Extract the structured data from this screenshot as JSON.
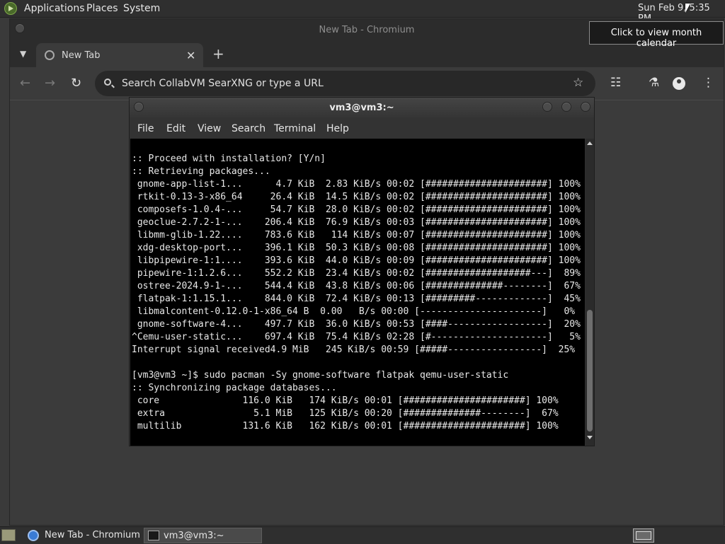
{
  "top_panel": {
    "menus": [
      "Applications",
      "Places",
      "System"
    ],
    "clock": "Sun Feb  9,  5:35 PM",
    "tooltip": "Click to view month calendar"
  },
  "chromium": {
    "window_title": "New Tab - Chromium",
    "tab_title": "New Tab",
    "omnibox_placeholder": "Search CollabVM SearXNG or type a URL"
  },
  "terminal": {
    "window_title": "vm3@vm3:~",
    "menus": [
      "File",
      "Edit",
      "View",
      "Search",
      "Terminal",
      "Help"
    ],
    "lines": [
      ":: Proceed with installation? [Y/n]",
      ":: Retrieving packages...",
      " gnome-app-list-1...      4.7 KiB  2.83 KiB/s 00:02 [######################] 100%",
      " rtkit-0.13-3-x86_64     26.4 KiB  14.5 KiB/s 00:02 [######################] 100%",
      " composefs-1.0.4-...     54.7 KiB  28.0 KiB/s 00:02 [######################] 100%",
      " geoclue-2.7.2-1-...    206.4 KiB  76.9 KiB/s 00:03 [######################] 100%",
      " libmm-glib-1.22....    783.6 KiB   114 KiB/s 00:07 [######################] 100%",
      " xdg-desktop-port...    396.1 KiB  50.3 KiB/s 00:08 [######################] 100%",
      " libpipewire-1:1....    393.6 KiB  44.0 KiB/s 00:09 [######################] 100%",
      " pipewire-1:1.2.6...    552.2 KiB  23.4 KiB/s 00:02 [###################---]  89%",
      " ostree-2024.9-1-...    544.4 KiB  43.8 KiB/s 00:06 [##############--------]  67%",
      " flatpak-1:1.15.1...    844.0 KiB  72.4 KiB/s 00:13 [#########-------------]  45%",
      " libmalcontent-0.12.0-1-x86_64 B  0.00   B/s 00:00 [----------------------]   0%",
      " gnome-software-4...    497.7 KiB  36.0 KiB/s 00:53 [####------------------]  20%",
      "^Cemu-user-static...    697.4 KiB  75.4 KiB/s 02:28 [#---------------------]   5%",
      "Interrupt signal received4.9 MiB   245 KiB/s 00:59 [#####-----------------]  25%",
      "",
      "[vm3@vm3 ~]$ sudo pacman -Sy gnome-software flatpak qemu-user-static",
      ":: Synchronizing package databases...",
      " core               116.0 KiB   174 KiB/s 00:01 [######################] 100%",
      " extra                5.1 MiB   125 KiB/s 00:20 [##############--------]  67%",
      " multilib           131.6 KiB   162 KiB/s 00:01 [######################] 100%"
    ]
  },
  "taskbar": {
    "tasks": [
      "New Tab - Chromium",
      "vm3@vm3:~"
    ]
  },
  "icons": {
    "nav": [
      "back-icon",
      "forward-icon",
      "reload-icon"
    ],
    "toolbar_right": [
      "extensions-icon",
      "labs-icon",
      "profile-icon",
      "menu-icon"
    ]
  }
}
